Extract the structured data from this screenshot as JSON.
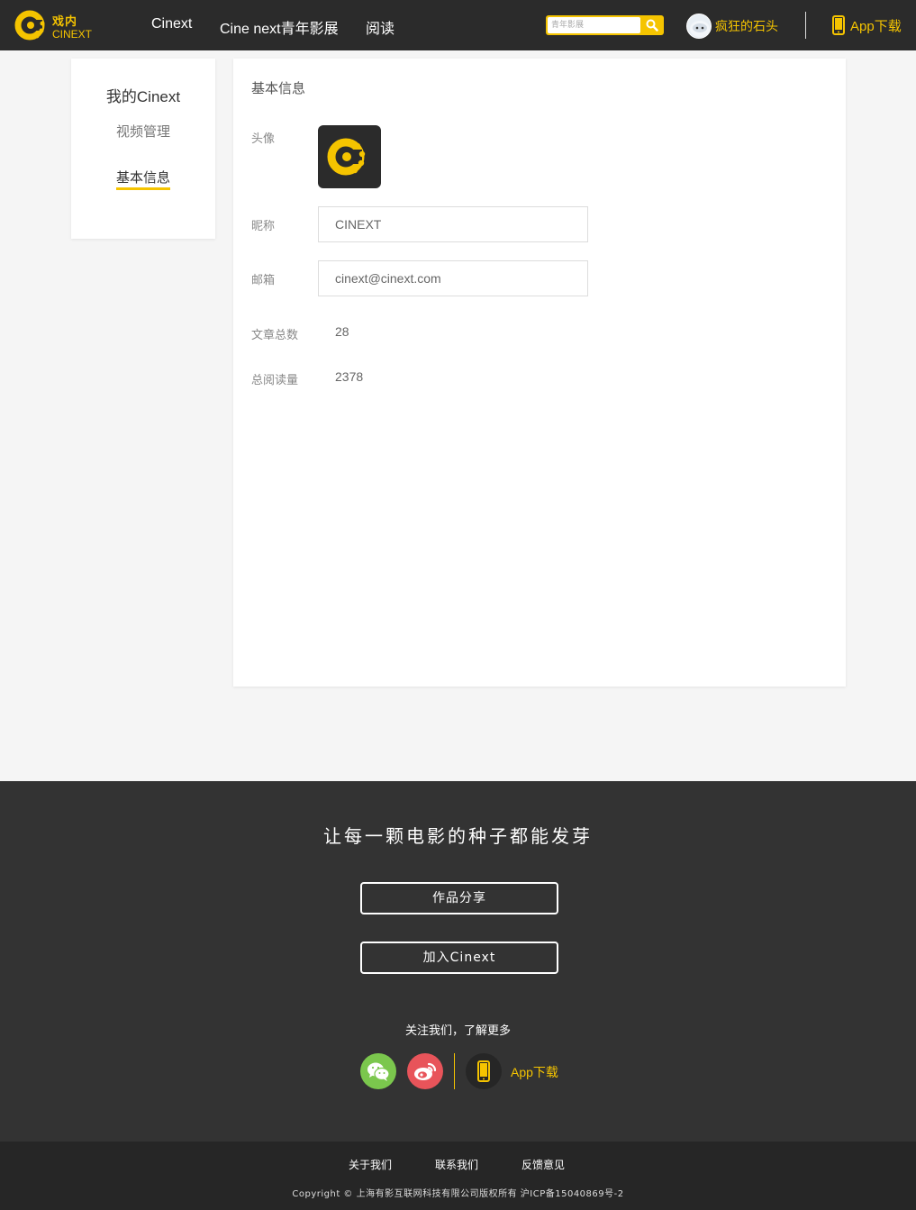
{
  "colors": {
    "accent": "#f5c400",
    "header_bg": "#2b2b2b",
    "footer_bg": "#333333",
    "bottom_bg": "#262626"
  },
  "header": {
    "logo_cn": "戏内",
    "logo_en": "CINEXT",
    "nav": [
      "Cinext",
      "Cine next青年影展",
      "阅读"
    ],
    "search_placeholder": "青年影展",
    "search_icon": "search-icon",
    "user_name": "疯狂的石头",
    "app_download": "App下载"
  },
  "sidebar": {
    "title": "我的Cinext",
    "items": [
      {
        "label": "视频管理",
        "active": false
      },
      {
        "label": "基本信息",
        "active": true
      }
    ]
  },
  "profile": {
    "title": "基本信息",
    "avatar_label": "头像",
    "nickname_label": "昵称",
    "nickname_value": "CINEXT",
    "email_label": "邮箱",
    "email_value": "cinext@cinext.com",
    "articles_label": "文章总数",
    "articles_value": "28",
    "reads_label": "总阅读量",
    "reads_value": "2378"
  },
  "footer": {
    "slogan": "让每一颗电影的种子都能发芽",
    "share_button": "作品分享",
    "join_button": "加入Cinext",
    "follow_text": "关注我们，了解更多",
    "social_icons": [
      "wechat-icon",
      "weibo-icon",
      "phone-icon"
    ],
    "app_download": "App下载",
    "links": [
      "关于我们",
      "联系我们",
      "反馈意见"
    ],
    "copyright": "Copyright © 上海有影互联网科技有限公司版权所有 沪ICP备15040869号-2"
  }
}
